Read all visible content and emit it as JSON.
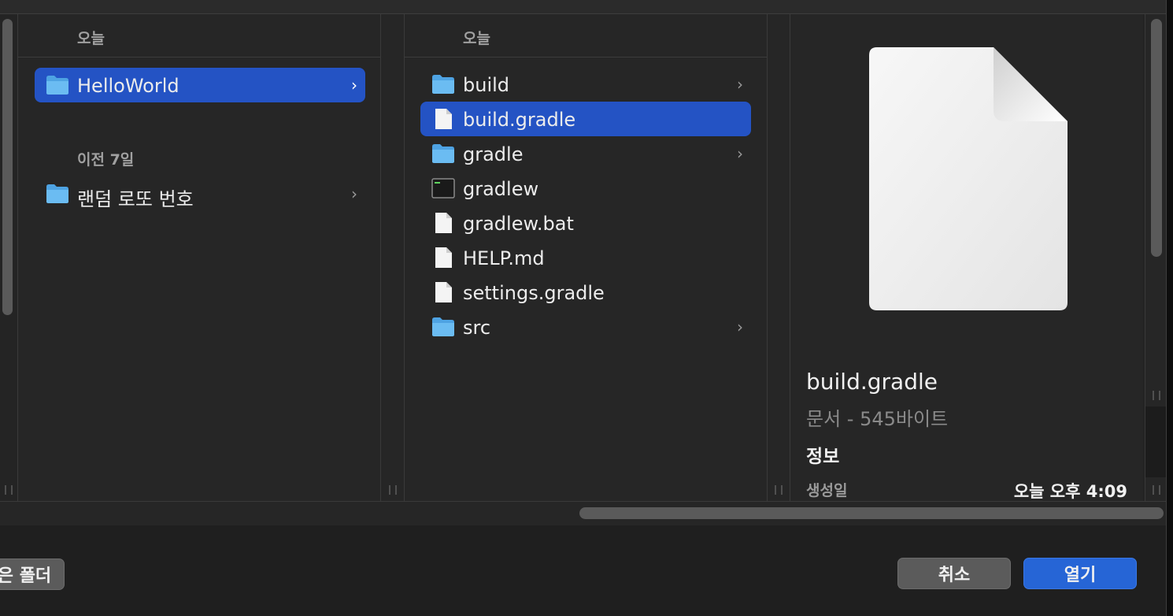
{
  "column1": {
    "sections": [
      {
        "header": "오늘",
        "items": [
          {
            "label": "HelloWorld",
            "icon": "folder-icon",
            "has_children": true,
            "selected": true
          }
        ]
      },
      {
        "header": "이전 7일",
        "items": [
          {
            "label": "랜덤 로또 번호",
            "icon": "folder-icon",
            "has_children": true,
            "selected": false
          }
        ]
      }
    ]
  },
  "column2": {
    "header": "오늘",
    "items": [
      {
        "label": "build",
        "icon": "folder-icon",
        "has_children": true,
        "selected": false
      },
      {
        "label": "build.gradle",
        "icon": "document-icon",
        "has_children": false,
        "selected": true
      },
      {
        "label": "gradle",
        "icon": "folder-icon",
        "has_children": true,
        "selected": false
      },
      {
        "label": "gradlew",
        "icon": "terminal-exec-icon",
        "has_children": false,
        "selected": false
      },
      {
        "label": "gradlew.bat",
        "icon": "document-icon",
        "has_children": false,
        "selected": false
      },
      {
        "label": "HELP.md",
        "icon": "document-icon",
        "has_children": false,
        "selected": false
      },
      {
        "label": "settings.gradle",
        "icon": "document-icon",
        "has_children": false,
        "selected": false
      },
      {
        "label": "src",
        "icon": "folder-icon",
        "has_children": true,
        "selected": false
      }
    ]
  },
  "preview": {
    "file_name": "build.gradle",
    "kind_size": "문서 - 545바이트",
    "info_heading": "정보",
    "created_label": "생성일",
    "created_value": "오늘 오후 4:09"
  },
  "footer": {
    "new_folder_label": "은 폴더",
    "cancel_label": "취소",
    "open_label": "열기"
  },
  "colors": {
    "selection": "#2453c4",
    "primary_button": "#2665d6",
    "folder": "#5aaeea"
  }
}
